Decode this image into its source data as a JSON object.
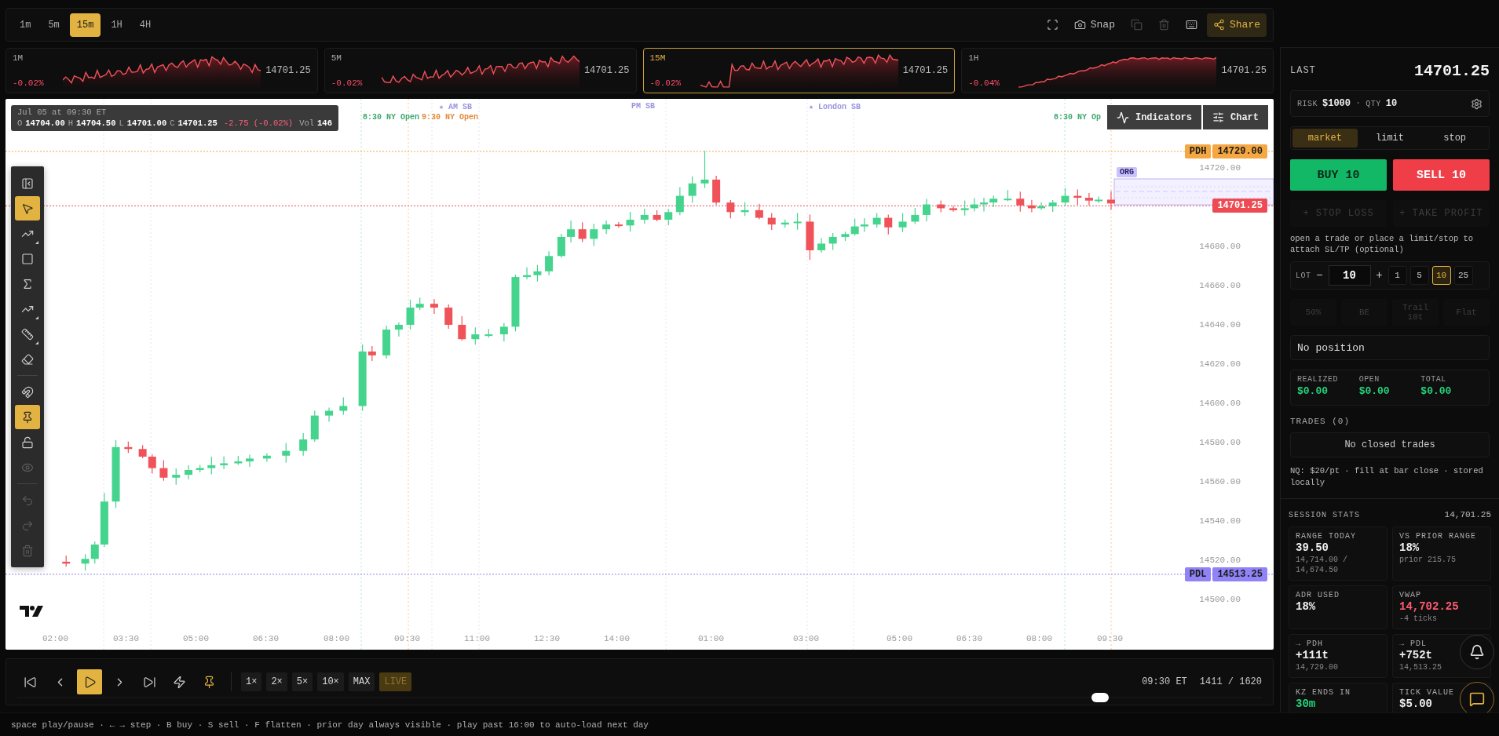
{
  "timeframes": [
    {
      "label": "1m",
      "selected": false
    },
    {
      "label": "5m",
      "selected": false
    },
    {
      "label": "15m",
      "selected": true
    },
    {
      "label": "1H",
      "selected": false
    },
    {
      "label": "4H",
      "selected": false
    }
  ],
  "toolbar_actions": [
    {
      "kind": "fullscreen",
      "disabled": false,
      "active": false
    },
    {
      "kind": "snap",
      "label": "Snap",
      "disabled": false,
      "active": false
    },
    {
      "kind": "copy",
      "disabled": true,
      "active": false
    },
    {
      "kind": "delete",
      "disabled": true,
      "active": false
    },
    {
      "kind": "keyboard",
      "disabled": false,
      "active": false
    },
    {
      "kind": "share",
      "label": "Share",
      "disabled": false,
      "active": true
    }
  ],
  "mini_charts": [
    {
      "label": "1M",
      "change": "-0.02%",
      "price": "14701.25",
      "selected": false
    },
    {
      "label": "5M",
      "change": "-0.02%",
      "price": "14701.25",
      "selected": false
    },
    {
      "label": "15M",
      "change": "-0.02%",
      "price": "14701.25",
      "selected": true
    },
    {
      "label": "1H",
      "change": "-0.04%",
      "price": "14701.25",
      "selected": false
    }
  ],
  "chart": {
    "ohlc": {
      "date": "Jul 05 at 09:30 ET",
      "fields": [
        {
          "label": "O",
          "value": "14704.00"
        },
        {
          "label": "H",
          "value": "14704.50"
        },
        {
          "label": "L",
          "value": "14701.00"
        },
        {
          "label": "C",
          "value": "14701.25"
        }
      ],
      "change": "-2.75 (-0.02%)",
      "volume_label": "Vol",
      "volume": "146"
    },
    "buttons": [
      {
        "kind": "indicators",
        "label": "Indicators"
      },
      {
        "kind": "chart",
        "label": "Chart"
      }
    ],
    "session_labels": [
      {
        "text": "★ AM SB",
        "color": "#9a94e0"
      },
      {
        "text": "PM SB",
        "color": "#9a94e0"
      },
      {
        "text": "★ London SB",
        "color": "#9a94e0"
      },
      {
        "text": "8:30 NY Open",
        "color": "#3fa86e"
      },
      {
        "text": "9:30 NY Open",
        "color": "#e08a3c"
      },
      {
        "text": "8:30 NY Op",
        "color": "#3fa86e"
      }
    ],
    "price_levels": [
      {
        "label": "PDH",
        "value": "14729.00",
        "color": "#f5a742"
      },
      {
        "label": "PDL",
        "value": "14513.25",
        "color": "#8f83f5"
      }
    ],
    "last_price": "14701.25",
    "range_label": "ORG",
    "price_axis": [
      "14720.00",
      "14680.00",
      "14660.00",
      "14640.00",
      "14620.00",
      "14600.00",
      "14580.00",
      "14560.00",
      "14540.00",
      "14520.00",
      "14500.00"
    ],
    "time_axis": [
      "02:00",
      "03:30",
      "05:00",
      "06:30",
      "08:00",
      "09:30",
      "11:00",
      "12:30",
      "14:00",
      "01:00",
      "03:00",
      "05:00",
      "06:30",
      "08:00",
      "09:30"
    ],
    "tools": [
      {
        "kind": "panel",
        "selected": false,
        "disabled": false,
        "submenu": false
      },
      {
        "kind": "cursor",
        "selected": true,
        "disabled": false,
        "submenu": false
      },
      {
        "kind": "trend",
        "selected": false,
        "disabled": false,
        "submenu": true
      },
      {
        "kind": "rectangle",
        "selected": false,
        "disabled": false,
        "submenu": false
      },
      {
        "kind": "sigma",
        "selected": false,
        "disabled": false,
        "submenu": false
      },
      {
        "kind": "trend",
        "selected": false,
        "disabled": false,
        "submenu": true
      },
      {
        "kind": "ruler",
        "selected": false,
        "disabled": false,
        "submenu": true
      },
      {
        "kind": "eraser",
        "selected": false,
        "disabled": false,
        "submenu": false
      },
      {
        "kind": "divider"
      },
      {
        "kind": "magnet",
        "selected": false,
        "disabled": false,
        "submenu": false
      },
      {
        "kind": "pin",
        "selected": true,
        "disabled": false,
        "submenu": false
      },
      {
        "kind": "lock",
        "selected": false,
        "disabled": false,
        "submenu": false
      },
      {
        "kind": "eye",
        "selected": false,
        "disabled": true,
        "submenu": false
      },
      {
        "kind": "divider"
      },
      {
        "kind": "undo",
        "selected": false,
        "disabled": true,
        "submenu": false
      },
      {
        "kind": "redo",
        "selected": false,
        "disabled": true,
        "submenu": false
      },
      {
        "kind": "trash",
        "selected": false,
        "disabled": true,
        "submenu": false
      }
    ]
  },
  "replay": {
    "controls": [
      {
        "kind": "first",
        "selected": false,
        "highlighted": false
      },
      {
        "kind": "prev",
        "selected": false,
        "highlighted": false
      },
      {
        "kind": "play",
        "selected": true,
        "highlighted": false
      },
      {
        "kind": "next",
        "selected": false,
        "highlighted": false
      },
      {
        "kind": "last",
        "selected": false,
        "highlighted": false
      },
      {
        "kind": "flash",
        "selected": false,
        "highlighted": false
      },
      {
        "kind": "pin",
        "selected": false,
        "highlighted": true
      }
    ],
    "speeds": [
      {
        "label": "1×",
        "kind": "speed"
      },
      {
        "label": "2×",
        "kind": "speed"
      },
      {
        "label": "5×",
        "kind": "speed"
      },
      {
        "label": "10×",
        "kind": "speed"
      },
      {
        "label": "MAX",
        "kind": "speed"
      },
      {
        "label": "LIVE",
        "kind": "live"
      }
    ],
    "time": "09:30 ET",
    "counter": "1411 / 1620",
    "scrubber": {
      "level": 0.87
    }
  },
  "trade_panel": {
    "last_label": "LAST",
    "last": "14701.25",
    "risk_label": "RISK",
    "risk": "$1000",
    "separator": "·",
    "qty_label": "QTY",
    "qty": "10",
    "order_types": [
      {
        "label": "market",
        "selected": true
      },
      {
        "label": "limit",
        "selected": false
      },
      {
        "label": "stop",
        "selected": false
      }
    ],
    "buy": "BUY 10",
    "sell": "SELL 10",
    "attach": [
      {
        "label": "+ STOP LOSS",
        "disabled": true
      },
      {
        "label": "+ TAKE PROFIT",
        "disabled": true
      }
    ],
    "hint": "open a trade or place a limit/stop to attach SL/TP (optional)",
    "lot": {
      "label": "LOT",
      "minus": "−",
      "value": "10",
      "plus": "+",
      "presets": [
        {
          "label": "1",
          "selected": false
        },
        {
          "label": "5",
          "selected": false
        },
        {
          "label": "10",
          "selected": true
        },
        {
          "label": "25",
          "selected": false
        }
      ]
    },
    "quick_actions": [
      {
        "label": "50%",
        "disabled": true
      },
      {
        "label": "BE",
        "disabled": true
      },
      {
        "label": "Trail 10t",
        "disabled": true
      },
      {
        "label": "Flat",
        "disabled": true
      }
    ],
    "position": "No position",
    "pnl": [
      {
        "label": "REALIZED",
        "value": "$0.00"
      },
      {
        "label": "OPEN",
        "value": "$0.00"
      },
      {
        "label": "TOTAL",
        "value": "$0.00"
      }
    ],
    "trades_label": "TRADES (0)",
    "trades_empty": "No closed trades",
    "note": "NQ: $20/pt · fill at bar close · stored locally"
  },
  "session_stats": {
    "title": "SESSION STATS",
    "price": "14,701.25",
    "cards": [
      {
        "label": "RANGE TODAY",
        "value": "39.50",
        "sub": "14,714.00 / 14,674.50",
        "color": "#f0f0f0"
      },
      {
        "label": "VS PRIOR RANGE",
        "value": "18%",
        "sub": "prior 215.75",
        "color": "#f0f0f0"
      },
      {
        "label": "ADR USED",
        "value": "18%",
        "color": "#f0f0f0"
      },
      {
        "label": "VWAP",
        "value": "14,702.25",
        "sub": "-4 ticks",
        "color": "#ff5c72"
      },
      {
        "label": "→ PDH",
        "value": "+111t",
        "sub": "14,729.00",
        "color": "#f0f0f0"
      },
      {
        "label": "→ PDL",
        "value": "+752t",
        "sub": "14,513.25",
        "color": "#f0f0f0"
      },
      {
        "label": "KZ ENDS IN",
        "value": "30m",
        "color": "#22d37a"
      },
      {
        "label": "TICK VALUE",
        "value": "$5.00",
        "color": "#f0f0f0"
      }
    ]
  },
  "footer_hint": "space play/pause · ← → step · B buy · S sell · F flatten · prior day always visible · play past 16:00 to auto-load next day"
}
